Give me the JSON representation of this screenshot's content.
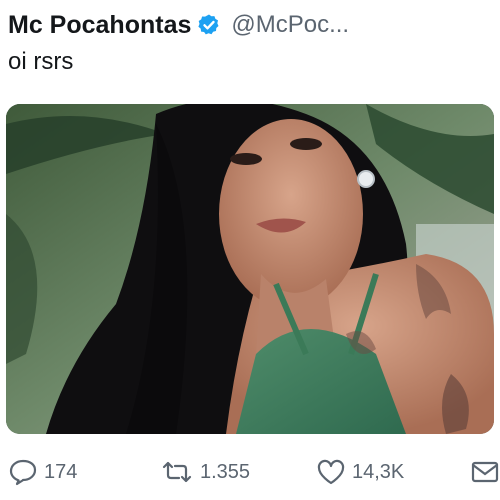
{
  "tweet": {
    "display_name": "Mc Pocahontas",
    "handle": "@McPoc...",
    "text": "oi rsrs",
    "verified": true
  },
  "media": {
    "icon": "photo-image",
    "alt": ""
  },
  "actions": {
    "reply_count": "174",
    "retweet_count": "1.355",
    "like_count": "14,3K"
  },
  "colors": {
    "verified_blue": "#1da1f2",
    "muted_text": "#5b6570",
    "text": "#14171a"
  }
}
